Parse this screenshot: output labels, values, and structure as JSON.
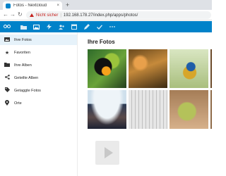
{
  "browser": {
    "tab_title": "Fotos - Nextcloud",
    "tab_close": "×",
    "new_tab": "+",
    "security_label": "Nicht sicher",
    "address_separator": "|",
    "url": "192.168.178.27/index.php/apps/photos/"
  },
  "header": {
    "apps": [
      {
        "icon": "folder-icon"
      },
      {
        "icon": "image-icon"
      },
      {
        "icon": "activity-icon"
      },
      {
        "icon": "contacts-icon"
      },
      {
        "icon": "calendar-icon"
      },
      {
        "icon": "edit-icon"
      },
      {
        "icon": "check-icon"
      },
      {
        "icon": "more-icon"
      }
    ]
  },
  "sidebar": {
    "items": [
      {
        "label": "Ihre Fotos",
        "icon": "image-icon",
        "active": true
      },
      {
        "label": "Favoriten",
        "icon": "star-icon"
      },
      {
        "label": "Ihre Alben",
        "icon": "folder-icon"
      },
      {
        "label": "Geteilte Alben",
        "icon": "share-icon"
      },
      {
        "label": "Getaggte Fotos",
        "icon": "tag-icon"
      },
      {
        "label": "Orte",
        "icon": "location-icon"
      }
    ]
  },
  "main": {
    "title": "Ihre Fotos"
  }
}
